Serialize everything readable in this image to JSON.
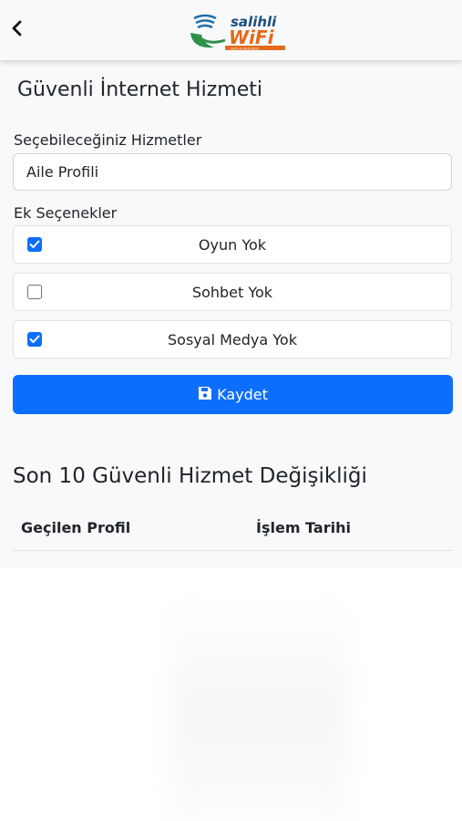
{
  "header": {
    "back_icon": "chevron-left-icon",
    "logo": {
      "brand_top": "salihli",
      "brand_bottom": "WiFi",
      "tagline": "Hızlı ve Kesintisiz",
      "colors": {
        "top": "#1d4f7a",
        "bottom": "#e36a1a",
        "green": "#2f8f4b",
        "blue": "#1e6fa8"
      }
    }
  },
  "page": {
    "title": "Güvenli İnternet Hizmeti"
  },
  "services": {
    "label": "Seçebileceğiniz Hizmetler",
    "selected_value": "Aile Profili"
  },
  "extras": {
    "label": "Ek Seçenekler",
    "options": [
      {
        "label": "Oyun Yok",
        "checked": true
      },
      {
        "label": "Sohbet Yok",
        "checked": false
      },
      {
        "label": "Sosyal Medya Yok",
        "checked": true
      }
    ]
  },
  "save_button": {
    "label": "Kaydet",
    "icon": "floppy-disk-icon"
  },
  "history": {
    "title": "Son 10 Güvenli Hizmet Değişikliği",
    "columns": [
      "Geçilen Profil",
      "İşlem Tarihi"
    ],
    "rows": []
  },
  "colors": {
    "primary": "#0d6efd",
    "background": "#f8f9fa",
    "text": "#212529",
    "border": "#ced4da"
  }
}
